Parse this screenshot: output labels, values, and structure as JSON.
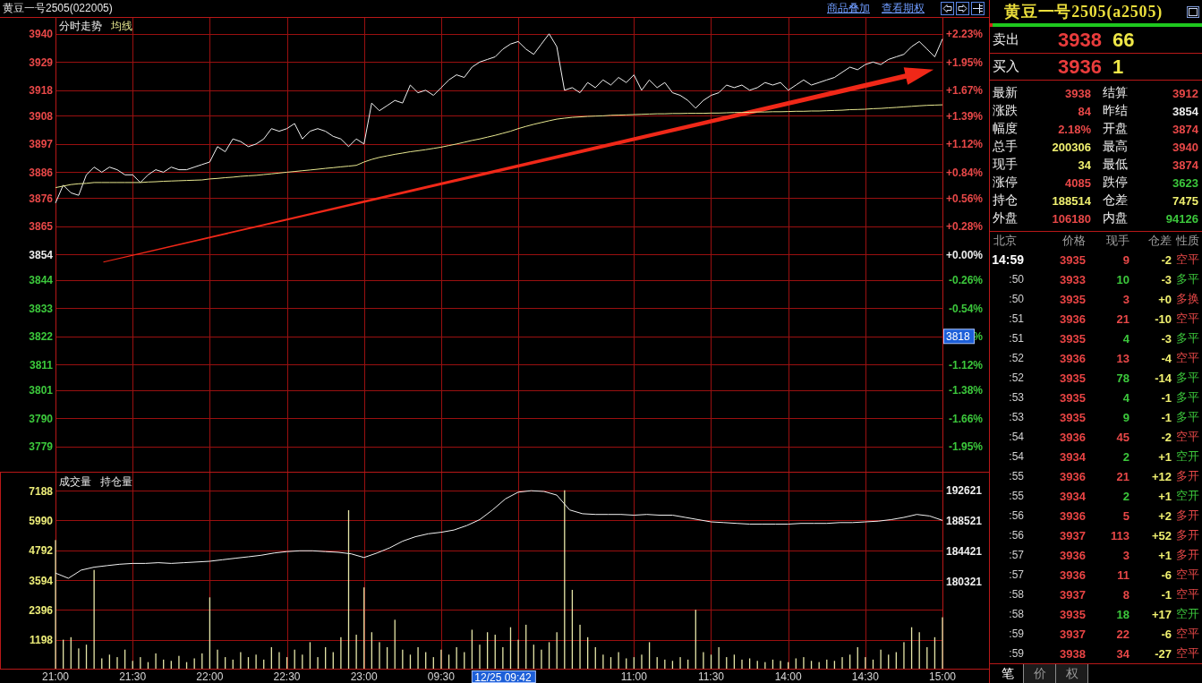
{
  "header": {
    "title": "黄豆一号2505(022005)",
    "links": [
      "商品叠加",
      "查看期权"
    ]
  },
  "price_chart": {
    "percent_axis": [
      {
        "label": "+2.23%",
        "color": "#e84848"
      },
      {
        "label": "+1.95%",
        "color": "#e84848"
      },
      {
        "label": "+1.67%",
        "color": "#e84848"
      },
      {
        "label": "+1.39%",
        "color": "#e84848"
      },
      {
        "label": "+1.12%",
        "color": "#e84848"
      },
      {
        "label": "+0.84%",
        "color": "#e84848"
      },
      {
        "label": "+0.56%",
        "color": "#e84848"
      },
      {
        "label": "+0.28%",
        "color": "#e84848"
      },
      {
        "label": "+0.00%",
        "color": "#ececec"
      },
      {
        "label": "-0.26%",
        "color": "#3cc83c"
      },
      {
        "label": "-0.54%",
        "color": "#3cc83c"
      },
      {
        "label": "%",
        "color": "#3cc83c",
        "cursor": "3818"
      },
      {
        "label": "-1.12%",
        "color": "#3cc83c"
      },
      {
        "label": "-1.38%",
        "color": "#3cc83c"
      },
      {
        "label": "-1.66%",
        "color": "#3cc83c"
      },
      {
        "label": "-1.95%",
        "color": "#3cc83c"
      }
    ],
    "chart_data": {
      "type": "line",
      "categories": [
        null,
        null,
        null,
        null,
        null,
        null,
        null,
        null,
        null,
        null,
        null,
        null,
        null,
        null,
        null,
        null,
        null,
        null,
        null,
        null,
        null,
        null,
        null,
        null,
        null,
        null,
        null,
        null,
        null,
        null,
        null,
        null,
        null,
        null,
        null,
        null,
        null,
        null,
        null,
        null,
        null,
        null,
        null,
        null,
        null,
        null,
        null,
        null,
        null,
        null,
        null,
        null,
        null,
        null,
        null,
        null,
        null,
        null,
        null,
        null,
        null,
        null,
        null,
        null,
        null,
        null,
        null,
        null,
        null,
        null,
        null,
        null,
        null,
        null,
        null,
        null,
        null,
        null,
        null,
        null,
        null,
        null,
        null,
        null,
        null,
        null,
        null,
        null,
        null,
        null,
        null,
        null,
        null,
        null,
        null,
        null,
        null,
        null,
        null,
        null,
        null,
        null,
        null,
        null,
        null,
        null,
        null,
        null,
        null,
        null,
        null,
        null,
        null,
        null,
        null,
        null
      ],
      "series": [
        {
          "name": "分时走势",
          "color": "#f2f2f2",
          "values": [
            3874,
            3881,
            3878,
            3877,
            3885,
            3888,
            3886,
            3888,
            3887,
            3885,
            3885,
            3882,
            3885,
            3887,
            3886,
            3888,
            3887,
            3887,
            3888,
            3889,
            3890,
            3896,
            3894,
            3899,
            3898,
            3896,
            3897,
            3899,
            3903,
            3902,
            3903,
            3905,
            3899,
            3902,
            3903,
            3902,
            3900,
            3899,
            3896,
            3899,
            3897,
            3913,
            3910,
            3912,
            3914,
            3913,
            3920,
            3917,
            3918,
            3916,
            3919,
            3922,
            3924,
            3923,
            3927,
            3929,
            3930,
            3931,
            3934,
            3936,
            3937,
            3934,
            3932,
            3936,
            3940,
            3935,
            3918,
            3919,
            3917,
            3921,
            3919,
            3922,
            3920,
            3923,
            3921,
            3924,
            3918,
            3922,
            3919,
            3921,
            3917,
            3916,
            3914,
            3911,
            3914,
            3916,
            3917,
            3920,
            3919,
            3920,
            3918,
            3919,
            3921,
            3920,
            3921,
            3918,
            3920,
            3922,
            3920,
            3921,
            3922,
            3923,
            3925,
            3927,
            3926,
            3928,
            3929,
            3928,
            3930,
            3931,
            3932,
            3935,
            3937,
            3934,
            3931,
            3938
          ]
        },
        {
          "name": "均线",
          "color": "#e8e890",
          "values": [
            3880,
            3880.6,
            3881.2,
            3881.5,
            3881.7,
            3882,
            3882,
            3882,
            3882,
            3882,
            3882,
            3882,
            3882.2,
            3882.3,
            3882.5,
            3882.6,
            3882.7,
            3882.8,
            3882.9,
            3883,
            3883.4,
            3883.6,
            3883.9,
            3884.1,
            3884.4,
            3884.6,
            3884.8,
            3885.1,
            3885.4,
            3885.7,
            3886,
            3886.3,
            3886.6,
            3886.9,
            3887.2,
            3887.5,
            3887.8,
            3888.1,
            3888.4,
            3888.7,
            3890,
            3891,
            3891.8,
            3892.4,
            3893,
            3893.5,
            3894,
            3894.4,
            3894.8,
            3895.3,
            3895.8,
            3896.4,
            3897,
            3897.7,
            3898.4,
            3899,
            3899.7,
            3900.4,
            3901.2,
            3902,
            3903,
            3903.9,
            3904.7,
            3905.4,
            3906.1,
            3906.7,
            3907.1,
            3907.4,
            3907.6,
            3907.8,
            3907.9,
            3908,
            3908.2,
            3908.3,
            3908.4,
            3908.5,
            3908.6,
            3908.7,
            3908.8,
            3908.8,
            3908.9,
            3908.9,
            3909,
            3909,
            3909,
            3909.1,
            3909.1,
            3909.2,
            3909.3,
            3909.3,
            3909.4,
            3909.5,
            3909.5,
            3909.6,
            3909.6,
            3909.7,
            3909.8,
            3909.8,
            3909.9,
            3909.9,
            3910,
            3910.1,
            3910.2,
            3910.4,
            3910.5,
            3910.6,
            3910.8,
            3910.9,
            3911.1,
            3911.3,
            3911.5,
            3911.7,
            3911.9,
            3912.1,
            3912.2,
            3912.3
          ]
        }
      ],
      "ylim": [
        3769.2,
        3946.2
      ],
      "yticks": [
        3940,
        3929,
        3918,
        3908,
        3897,
        3886,
        3876,
        3865,
        3854,
        3844,
        3833,
        3822,
        3811,
        3801,
        3790,
        3779
      ],
      "grid": true
    }
  },
  "volume_panel": {
    "volume": {
      "chart_data": {
        "type": "bar",
        "categories": [
          "21:00",
          null,
          null,
          null,
          null,
          null,
          null,
          null,
          null,
          null,
          "21:30",
          null,
          null,
          null,
          null,
          null,
          null,
          null,
          null,
          null,
          "22:00",
          null,
          null,
          null,
          null,
          null,
          null,
          null,
          null,
          null,
          "22:30",
          null,
          null,
          null,
          null,
          null,
          null,
          null,
          null,
          null,
          "23:00",
          null,
          null,
          null,
          null,
          null,
          null,
          null,
          null,
          null,
          "09:30",
          null,
          null,
          null,
          null,
          null,
          null,
          null,
          null,
          null,
          null,
          null,
          null,
          null,
          null,
          null,
          null,
          null,
          null,
          null,
          null,
          null,
          null,
          null,
          null,
          "11:00",
          null,
          null,
          null,
          null,
          null,
          null,
          null,
          null,
          null,
          "11:30",
          null,
          null,
          null,
          null,
          null,
          null,
          null,
          null,
          null,
          "14:00",
          null,
          null,
          null,
          null,
          null,
          null,
          null,
          null,
          null,
          "14:30",
          null,
          null,
          null,
          null,
          null,
          null,
          null,
          null,
          null,
          "15:00"
        ],
        "series": [
          {
            "name": "成交量",
            "color": "#e6e6a8",
            "values": [
              5200,
              1200,
              1300,
              850,
              1000,
              4000,
              450,
              600,
              500,
              800,
              350,
              500,
              300,
              650,
              400,
              350,
              550,
              300,
              450,
              650,
              2900,
              800,
              500,
              400,
              700,
              500,
              600,
              400,
              900,
              700,
              500,
              800,
              600,
              1100,
              500,
              900,
              700,
              1300,
              6400,
              1400,
              3300,
              1500,
              1100,
              900,
              2000,
              800,
              600,
              900,
              700,
              500,
              800,
              600,
              900,
              700,
              1600,
              1000,
              1500,
              1400,
              900,
              1700,
              1200,
              1800,
              1000,
              800,
              1100,
              1500,
              7200,
              3200,
              1800,
              1300,
              900,
              600,
              500,
              700,
              450,
              500,
              600,
              1100,
              500,
              400,
              350,
              500,
              400,
              2400,
              700,
              600,
              900,
              500,
              600,
              400,
              450,
              350,
              300,
              400,
              350,
              300,
              450,
              500,
              350,
              300,
              400,
              350,
              500,
              600,
              900,
              500,
              400,
              800,
              600,
              700,
              1100,
              1700,
              1500,
              900,
              1300,
              2100
            ]
          }
        ],
        "ylim": [
          0,
          7943
        ],
        "yticks": [
          1198,
          2396,
          3594,
          4792,
          5990,
          7188
        ],
        "grid": true,
        "annotations": [
          "12/25 09:42"
        ]
      }
    },
    "open_interest": {
      "chart_data": {
        "type": "line",
        "categories": [
          null,
          null,
          null,
          null,
          null,
          null,
          null,
          null,
          null,
          null,
          null,
          null,
          null,
          null,
          null,
          null,
          null,
          null,
          null,
          null,
          null,
          null,
          null,
          null,
          null,
          null,
          null,
          null,
          null,
          null,
          null,
          null,
          null,
          null,
          null,
          null,
          null,
          null,
          null,
          null,
          null,
          null,
          null,
          null,
          null,
          null,
          null,
          null,
          null,
          null,
          null,
          null,
          null,
          null,
          null,
          null,
          null,
          null,
          null,
          null,
          null,
          null,
          null,
          null,
          null,
          null,
          null,
          null,
          null,
          null
        ],
        "series": [
          {
            "name": "持仓量",
            "color": "#f2f2f2",
            "values": [
              181500,
              180800,
              181900,
              182300,
              182500,
              182700,
              182800,
              182800,
              182900,
              182800,
              182900,
              183000,
              183100,
              183300,
              183500,
              183700,
              183900,
              184200,
              184400,
              184500,
              184500,
              184400,
              184300,
              184100,
              183600,
              184200,
              184900,
              185800,
              186400,
              186800,
              187000,
              187300,
              187900,
              188700,
              190000,
              191500,
              192400,
              192600,
              192500,
              192000,
              190000,
              189500,
              189400,
              189400,
              189400,
              189300,
              189400,
              189300,
              189300,
              189000,
              188700,
              188400,
              188300,
              188200,
              188100,
              188100,
              188100,
              188100,
              188200,
              188200,
              188200,
              188300,
              188300,
              188400,
              188500,
              188700,
              189000,
              189400,
              189200,
              188600
            ]
          }
        ],
        "ylim": [
          168503,
          195153
        ],
        "yticks": [
          180321,
          184421,
          188521,
          192621
        ]
      }
    }
  },
  "quote_panel": {
    "title": "黄豆一号2505(a2505)",
    "orders": [
      {
        "label": "卖出",
        "price": "3938",
        "volume": "66"
      },
      {
        "label": "买入",
        "price": "3936",
        "volume": "1"
      }
    ],
    "stats": [
      {
        "label": "最新",
        "value": "3938",
        "color": "#e84848"
      },
      {
        "label": "结算",
        "value": "3912",
        "color": "#e84848"
      },
      {
        "label": "涨跌",
        "value": "84",
        "color": "#e84848"
      },
      {
        "label": "昨结",
        "value": "3854",
        "color": "#ececec"
      },
      {
        "label": "幅度",
        "value": "2.18%",
        "color": "#e84848"
      },
      {
        "label": "开盘",
        "value": "3874",
        "color": "#e84848"
      },
      {
        "label": "总手",
        "value": "200306",
        "color": "#f0f070"
      },
      {
        "label": "最高",
        "value": "3940",
        "color": "#e84848"
      },
      {
        "label": "现手",
        "value": "34",
        "color": "#f0f070"
      },
      {
        "label": "最低",
        "value": "3874",
        "color": "#e84848"
      },
      {
        "label": "涨停",
        "value": "4085",
        "color": "#e84848"
      },
      {
        "label": "跌停",
        "value": "3623",
        "color": "#3cc83c"
      },
      {
        "label": "持仓",
        "value": "188514",
        "color": "#f0f070"
      },
      {
        "label": "仓差",
        "value": "7475",
        "color": "#f0f070"
      },
      {
        "label": "外盘",
        "value": "106180",
        "color": "#e84848"
      },
      {
        "label": "内盘",
        "value": "94126",
        "color": "#3cc83c"
      }
    ],
    "trades": {
      "columns": [
        "北京",
        "价格",
        "现手",
        "仓差",
        "性质"
      ],
      "rows": [
        {
          "time": "14:59",
          "price": "3935",
          "volume": "9",
          "change": "-2",
          "nature": "空平",
          "color": "#e84848"
        },
        {
          "time": ":50",
          "price": "3933",
          "volume": "10",
          "change": "-3",
          "nature": "多平",
          "color": "#3cc83c"
        },
        {
          "time": ":50",
          "price": "3935",
          "volume": "3",
          "change": "+0",
          "nature": "多换",
          "color": "#e84848"
        },
        {
          "time": ":51",
          "price": "3936",
          "volume": "21",
          "change": "-10",
          "nature": "空平",
          "color": "#e84848"
        },
        {
          "time": ":51",
          "price": "3935",
          "volume": "4",
          "change": "-3",
          "nature": "多平",
          "color": "#3cc83c"
        },
        {
          "time": ":52",
          "price": "3936",
          "volume": "13",
          "change": "-4",
          "nature": "空平",
          "color": "#e84848"
        },
        {
          "time": ":52",
          "price": "3935",
          "volume": "78",
          "change": "-14",
          "nature": "多平",
          "color": "#3cc83c"
        },
        {
          "time": ":53",
          "price": "3935",
          "volume": "4",
          "change": "-1",
          "nature": "多平",
          "color": "#3cc83c"
        },
        {
          "time": ":53",
          "price": "3935",
          "volume": "9",
          "change": "-1",
          "nature": "多平",
          "color": "#3cc83c"
        },
        {
          "time": ":54",
          "price": "3936",
          "volume": "45",
          "change": "-2",
          "nature": "空平",
          "color": "#e84848"
        },
        {
          "time": ":54",
          "price": "3934",
          "volume": "2",
          "change": "+1",
          "nature": "空开",
          "color": "#3cc83c"
        },
        {
          "time": ":55",
          "price": "3936",
          "volume": "21",
          "change": "+12",
          "nature": "多开",
          "color": "#e84848"
        },
        {
          "time": ":55",
          "price": "3934",
          "volume": "2",
          "change": "+1",
          "nature": "空开",
          "color": "#3cc83c"
        },
        {
          "time": ":56",
          "price": "3936",
          "volume": "5",
          "change": "+2",
          "nature": "多开",
          "color": "#e84848"
        },
        {
          "time": ":56",
          "price": "3937",
          "volume": "113",
          "change": "+52",
          "nature": "多开",
          "color": "#e84848"
        },
        {
          "time": ":57",
          "price": "3936",
          "volume": "3",
          "change": "+1",
          "nature": "多开",
          "color": "#e84848"
        },
        {
          "time": ":57",
          "price": "3936",
          "volume": "11",
          "change": "-6",
          "nature": "空平",
          "color": "#e84848"
        },
        {
          "time": ":58",
          "price": "3937",
          "volume": "8",
          "change": "-1",
          "nature": "空平",
          "color": "#e84848"
        },
        {
          "time": ":58",
          "price": "3935",
          "volume": "18",
          "change": "+17",
          "nature": "空开",
          "color": "#3cc83c"
        },
        {
          "time": ":59",
          "price": "3937",
          "volume": "22",
          "change": "-6",
          "nature": "空平",
          "color": "#e84848"
        },
        {
          "time": ":59",
          "price": "3938",
          "volume": "34",
          "change": "-27",
          "nature": "空平",
          "color": "#e84848"
        }
      ]
    },
    "tabs": [
      {
        "label": "笔",
        "selected": true
      },
      {
        "label": "价",
        "selected": false
      },
      {
        "label": "权",
        "selected": false
      }
    ]
  }
}
